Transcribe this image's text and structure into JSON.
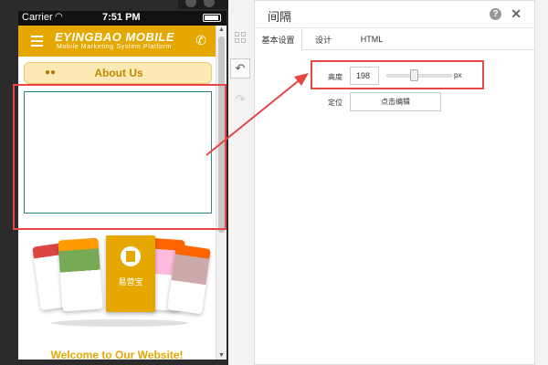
{
  "status_bar": {
    "carrier": "Carrier",
    "time": "7:51 PM"
  },
  "app": {
    "brand": "EYINGBAO MOBILE",
    "tagline": "Mobile Marketing System Platform",
    "about_label": "About Us",
    "promo_card_text": "易营宝",
    "welcome": "Welcome to Our Website!"
  },
  "panel": {
    "title": "间隔",
    "tabs": [
      {
        "label": "基本设置",
        "active": true
      },
      {
        "label": "设计",
        "active": false
      },
      {
        "label": "HTML",
        "active": false
      }
    ],
    "height_label": "高度",
    "height_value": "198",
    "height_slider_fraction": 0.4,
    "unit": "px",
    "position_label": "定位",
    "edit_button": "点击编辑"
  },
  "colors": {
    "brand": "#e4a800",
    "highlight": "#e84545",
    "spacer_border": "#2a8a8a"
  },
  "icons": [
    "menu-icon",
    "phone-icon",
    "users-icon",
    "grid-icon",
    "undo-icon",
    "redo-icon",
    "help-icon",
    "close-icon"
  ]
}
